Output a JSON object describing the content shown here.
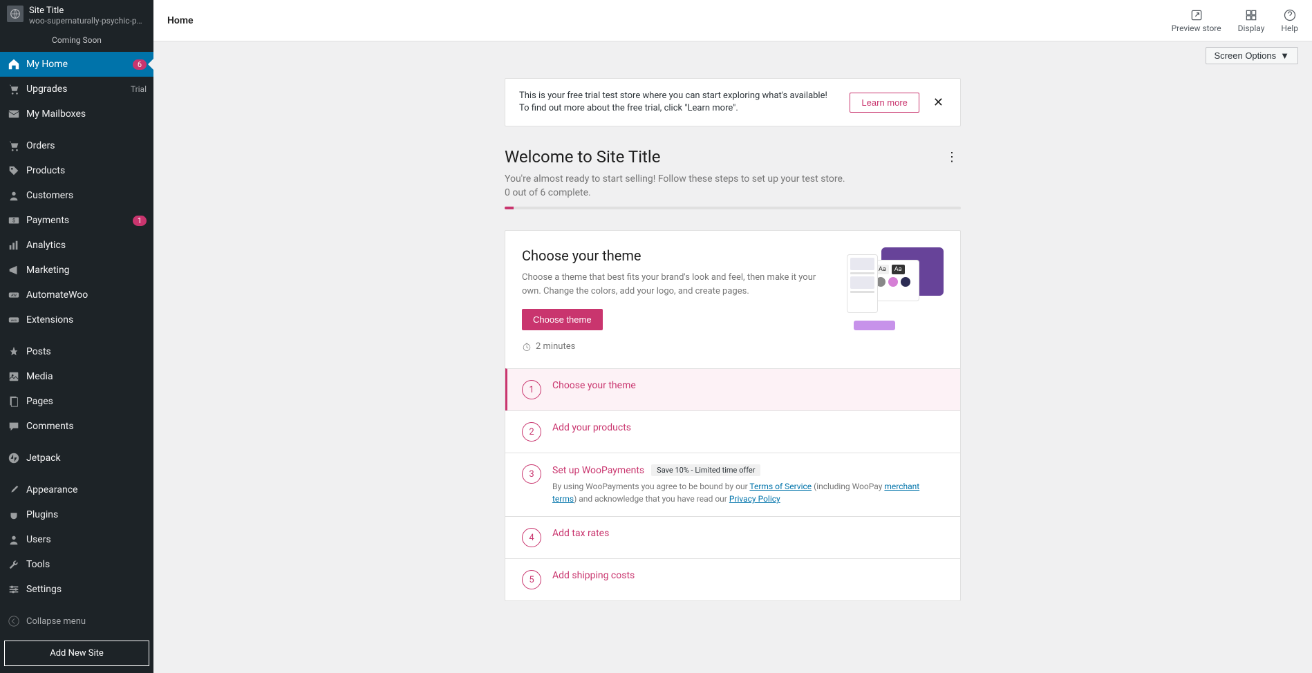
{
  "site": {
    "title": "Site Title",
    "slug": "woo-supernaturally-psychic-phantom",
    "status": "Coming Soon"
  },
  "nav": {
    "myHome": {
      "label": "My Home",
      "badge": "6"
    },
    "upgrades": {
      "label": "Upgrades",
      "tag": "Trial"
    },
    "mailboxes": {
      "label": "My Mailboxes"
    },
    "orders": {
      "label": "Orders"
    },
    "products": {
      "label": "Products"
    },
    "customers": {
      "label": "Customers"
    },
    "payments": {
      "label": "Payments",
      "badge": "1"
    },
    "analytics": {
      "label": "Analytics"
    },
    "marketing": {
      "label": "Marketing"
    },
    "automatewoo": {
      "label": "AutomateWoo"
    },
    "extensions": {
      "label": "Extensions"
    },
    "posts": {
      "label": "Posts"
    },
    "media": {
      "label": "Media"
    },
    "pages": {
      "label": "Pages"
    },
    "comments": {
      "label": "Comments"
    },
    "jetpack": {
      "label": "Jetpack"
    },
    "appearance": {
      "label": "Appearance"
    },
    "plugins": {
      "label": "Plugins"
    },
    "users": {
      "label": "Users"
    },
    "tools": {
      "label": "Tools"
    },
    "settings": {
      "label": "Settings"
    },
    "collapse": {
      "label": "Collapse menu"
    },
    "addSite": {
      "label": "Add New Site"
    }
  },
  "topbar": {
    "title": "Home",
    "preview": "Preview store",
    "display": "Display",
    "help": "Help"
  },
  "screenOptions": {
    "label": "Screen Options"
  },
  "trial": {
    "text": "This is your free trial test store where you can start exploring what's available! To find out more about the free trial, click \"Learn more\".",
    "learnMore": "Learn more"
  },
  "welcome": {
    "heading": "Welcome to Site Title",
    "sub": "You're almost ready to start selling! Follow these steps to set up your test store.",
    "progress": "0 out of 6 complete."
  },
  "hero": {
    "title": "Choose your theme",
    "desc": "Choose a theme that best fits your brand's look and feel, then make it your own. Change the colors, add your logo, and create pages.",
    "cta": "Choose theme",
    "time": "2 minutes"
  },
  "steps": {
    "s1": {
      "num": "1",
      "title": "Choose your theme"
    },
    "s2": {
      "num": "2",
      "title": "Add your products"
    },
    "s3": {
      "num": "3",
      "title": "Set up WooPayments",
      "pill": "Save 10% - Limited time offer",
      "desc1": "By using WooPayments you agree to be bound by our ",
      "tos": "Terms of Service",
      "desc2": " (including WooPay ",
      "merchant": "merchant terms",
      "desc3": ") and acknowledge that you have read our ",
      "privacy": "Privacy Policy"
    },
    "s4": {
      "num": "4",
      "title": "Add tax rates"
    },
    "s5": {
      "num": "5",
      "title": "Add shipping costs"
    }
  }
}
